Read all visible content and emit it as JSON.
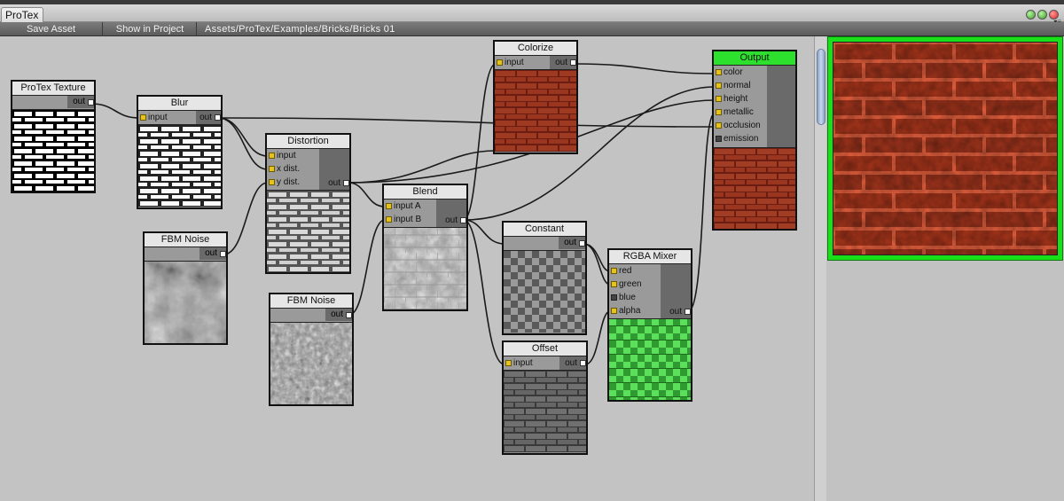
{
  "window": {
    "tab_label": "ProTex"
  },
  "toolbar": {
    "save_label": "Save Asset",
    "show_label": "Show in Project",
    "path": "Assets/ProTex/Examples/Bricks/Bricks 01"
  },
  "nodes": {
    "protex_texture": {
      "title": "ProTex Texture",
      "out": "out"
    },
    "blur": {
      "title": "Blur",
      "inputs": [
        "input"
      ],
      "out": "out"
    },
    "distortion": {
      "title": "Distortion",
      "inputs": [
        "input",
        "x dist.",
        "y dist."
      ],
      "out": "out"
    },
    "fbm_noise_1": {
      "title": "FBM Noise",
      "out": "out"
    },
    "fbm_noise_2": {
      "title": "FBM Noise",
      "out": "out"
    },
    "blend": {
      "title": "Blend",
      "inputs": [
        "input A",
        "input B"
      ],
      "out": "out"
    },
    "colorize": {
      "title": "Colorize",
      "inputs": [
        "input"
      ],
      "out": "out"
    },
    "constant": {
      "title": "Constant",
      "out": "out"
    },
    "offset": {
      "title": "Offset",
      "inputs": [
        "input"
      ],
      "out": "out"
    },
    "rgba_mixer": {
      "title": "RGBA Mixer",
      "inputs": [
        "red",
        "green",
        "blue",
        "alpha"
      ],
      "out": "out"
    },
    "output": {
      "title": "Output",
      "inputs": [
        "color",
        "normal",
        "height",
        "metallic",
        "occlusion",
        "emission"
      ]
    }
  },
  "colors": {
    "canvas": "#c3c3c3",
    "output_header": "#2ee02e",
    "preview_border": "#19e019",
    "brick_red": "#a33c22",
    "port_input": "#e8c21c"
  }
}
